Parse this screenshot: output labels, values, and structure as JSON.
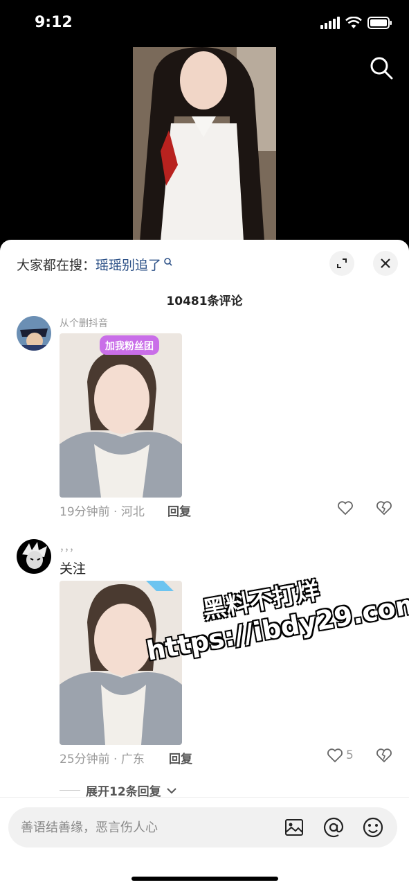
{
  "status_bar": {
    "time": "9:12"
  },
  "sheet": {
    "trending_label": "大家都在搜：",
    "trending_keyword": "瑶瑶别追了",
    "comment_count": "10481条评论"
  },
  "comments": [
    {
      "username": "从个删抖音",
      "text": "",
      "time_location": "19分钟前 · 河北",
      "reply_label": "回复",
      "like_count": "",
      "sticker_text": "加我粉丝团"
    },
    {
      "username": "，，，",
      "text": "关注",
      "time_location": "25分钟前 · 广东",
      "reply_label": "回复",
      "like_count": "5"
    }
  ],
  "expand_replies": "展开12条回复",
  "watermark": {
    "line1": "黑料不打烊",
    "line2": "https://ibdy29.com"
  },
  "composer": {
    "placeholder": "善语结善缘，恶言伤人心"
  },
  "colors": {
    "keyword": "#2a4f86",
    "meta": "#999999",
    "background": "#ffffff"
  }
}
